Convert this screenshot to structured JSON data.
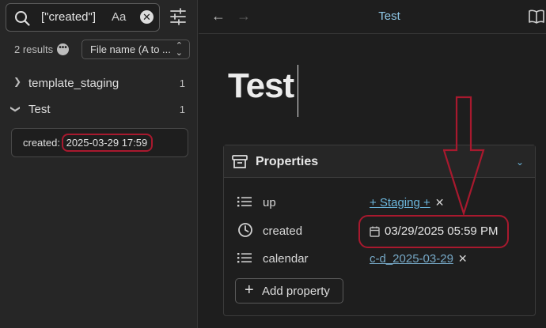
{
  "search": {
    "query": "[\"created\"]",
    "match_case_label": "Aa",
    "clear_glyph": "✕"
  },
  "results": {
    "count_label": "2 results",
    "more_glyph": "•••",
    "sort_label": "File name (A to ...",
    "sort_chevron": "⌃\n⌄",
    "groups": [
      {
        "arrow": "❯",
        "label": "template_staging",
        "count": "1"
      },
      {
        "arrow": "❯",
        "label": "Test",
        "count": "1"
      }
    ],
    "match": {
      "prefix": "created: ",
      "highlight": "2025-03-29 17:59"
    }
  },
  "toolbar": {
    "back_glyph": "←",
    "forward_glyph": "→",
    "title": "Test"
  },
  "note": {
    "title": "Test"
  },
  "properties": {
    "header": "Properties",
    "collapse_glyph": "⌄",
    "rows": [
      {
        "name": "up",
        "value": "+ Staging +",
        "remove": "✕"
      },
      {
        "name": "created",
        "value": "03/29/2025 05:59 PM"
      },
      {
        "name": "calendar",
        "value": "c-d_2025-03-29",
        "remove": "✕"
      }
    ],
    "add_glyph": "+",
    "add_label": "Add property"
  },
  "colors": {
    "accent": "#6cb7dd",
    "annotation": "#a8192e",
    "background": "#1e1e1e",
    "sidebar": "#262626"
  },
  "icons": {
    "search": "search-icon",
    "settings": "sliders-icon",
    "book": "book-icon",
    "properties": "archive-box-icon",
    "list": "list-icon",
    "clock": "clock-icon",
    "calendar": "calendar-icon"
  }
}
